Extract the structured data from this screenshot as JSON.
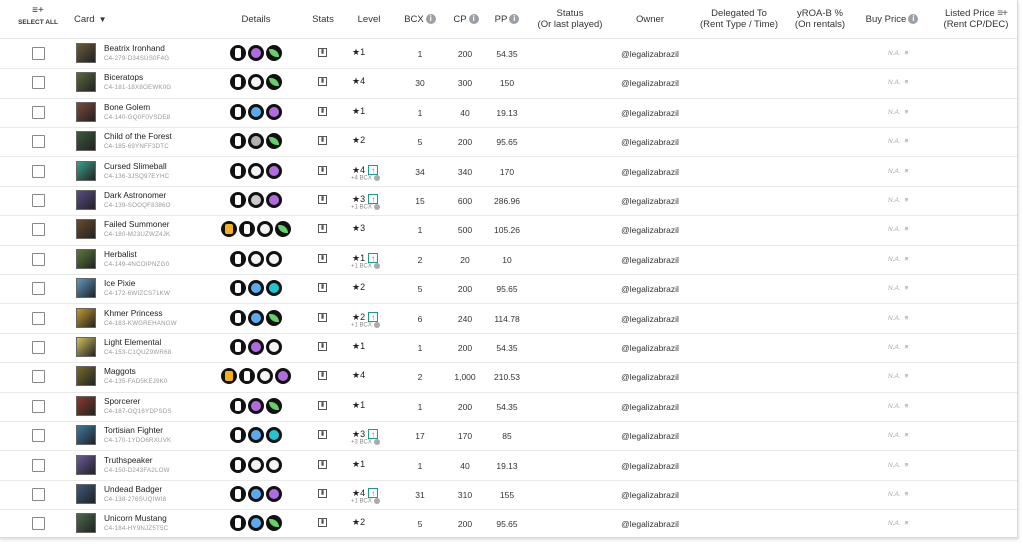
{
  "header": {
    "select_all": "SELECT ALL",
    "card": "Card",
    "details": "Details",
    "stats": "Stats",
    "level": "Level",
    "bcx": "BCX",
    "cp": "CP",
    "pp": "PP",
    "status": "Status",
    "status_sub": "(Or last played)",
    "owner": "Owner",
    "delegated": "Delegated To",
    "delegated_sub": "(Rent Type / Time)",
    "yroa": "yROA-B %",
    "yroa_sub": "(On rentals)",
    "buy_price": "Buy Price",
    "listed_price": "Listed Price",
    "listed_price_sub": "(Rent CP/DEC)"
  },
  "na_label": "N.A.",
  "rows": [
    {
      "name": "Beatrix Ironhand",
      "id": "C4-279-D34SUS0F4G",
      "details": [
        "white",
        "skull",
        "leaf"
      ],
      "level": "1",
      "up": false,
      "bcx_note": "",
      "bcx": "1",
      "cp": "200",
      "pp": "54.35",
      "owner": "@legalizabrazil",
      "color": "#6a5a3a"
    },
    {
      "name": "Biceratops",
      "id": "C4-181-18X8OEWK0G",
      "details": [
        "white",
        "star",
        "leaf"
      ],
      "level": "4",
      "up": false,
      "bcx_note": "",
      "bcx": "30",
      "cp": "300",
      "pp": "150",
      "owner": "@legalizabrazil",
      "color": "#5a6b3a"
    },
    {
      "name": "Bone Golem",
      "id": "C4-140-GQ0F0VSDE8",
      "details": [
        "white",
        "orb",
        "skull"
      ],
      "level": "1",
      "up": false,
      "bcx_note": "",
      "bcx": "1",
      "cp": "40",
      "pp": "19.13",
      "owner": "@legalizabrazil",
      "color": "#7a4a3a"
    },
    {
      "name": "Child of the Forest",
      "id": "C4-185-69YNFF3DTC",
      "details": [
        "white",
        "orb",
        "leaf"
      ],
      "level": "2",
      "up": false,
      "bcx_note": "",
      "bcx": "5",
      "cp": "200",
      "pp": "95.65",
      "owner": "@legalizabrazil",
      "color": "#3a5a3a"
    },
    {
      "name": "Cursed Slimeball",
      "id": "C4-136-3JSQ97EYHC",
      "details": [
        "white",
        "star",
        "skull"
      ],
      "level": "4",
      "up": true,
      "bcx_note": "+4 BCX",
      "bcx": "34",
      "cp": "340",
      "pp": "170",
      "owner": "@legalizabrazil",
      "color": "#3aa08a"
    },
    {
      "name": "Dark Astronomer",
      "id": "C4-139-SOOQF8386O",
      "details": [
        "white",
        "orb",
        "skull"
      ],
      "level": "3",
      "up": true,
      "bcx_note": "+1 BCX",
      "bcx": "15",
      "cp": "600",
      "pp": "286.96",
      "owner": "@legalizabrazil",
      "color": "#5a4a8a"
    },
    {
      "name": "Failed Summoner",
      "id": "C4-180-M23UZWZ4JK",
      "details": [
        "gold",
        "white",
        "star",
        "leaf"
      ],
      "level": "3",
      "up": false,
      "bcx_note": "",
      "bcx": "1",
      "cp": "500",
      "pp": "105.26",
      "owner": "@legalizabrazil",
      "color": "#6a4a2a"
    },
    {
      "name": "Herbalist",
      "id": "C4-149-4NCOIPNZG0",
      "details": [
        "white",
        "star",
        "star"
      ],
      "level": "1",
      "up": true,
      "bcx_note": "+1 BCX",
      "bcx": "2",
      "cp": "20",
      "pp": "10",
      "owner": "@legalizabrazil",
      "color": "#5a7a3a"
    },
    {
      "name": "Ice Pixie",
      "id": "C4-172-6WIZCS71KW",
      "details": [
        "white",
        "orb",
        "ring"
      ],
      "level": "2",
      "up": false,
      "bcx_note": "",
      "bcx": "5",
      "cp": "200",
      "pp": "95.65",
      "owner": "@legalizabrazil",
      "color": "#5a9ac0"
    },
    {
      "name": "Khmer Princess",
      "id": "C4-183-KWGREHANGW",
      "details": [
        "white",
        "orb",
        "leaf"
      ],
      "level": "2",
      "up": true,
      "bcx_note": "+1 BCX",
      "bcx": "6",
      "cp": "240",
      "pp": "114.78",
      "owner": "@legalizabrazil",
      "color": "#c09a2a"
    },
    {
      "name": "Light Elemental",
      "id": "C4-153-C1QUZ9WR68",
      "details": [
        "white",
        "skull",
        "star"
      ],
      "level": "1",
      "up": false,
      "bcx_note": "",
      "bcx": "1",
      "cp": "200",
      "pp": "54.35",
      "owner": "@legalizabrazil",
      "color": "#d0c060"
    },
    {
      "name": "Maggots",
      "id": "C4-135-FAD5KEJ9K0",
      "details": [
        "gold",
        "white",
        "star",
        "skull"
      ],
      "level": "4",
      "up": false,
      "bcx_note": "",
      "bcx": "2",
      "cp": "1,000",
      "pp": "210.53",
      "owner": "@legalizabrazil",
      "color": "#7a6a2a"
    },
    {
      "name": "Sporcerer",
      "id": "C4-187-OQ16YDPSDS",
      "details": [
        "white",
        "skull",
        "leaf"
      ],
      "level": "1",
      "up": false,
      "bcx_note": "",
      "bcx": "1",
      "cp": "200",
      "pp": "54.35",
      "owner": "@legalizabrazil",
      "color": "#8a3a2a"
    },
    {
      "name": "Tortisian Fighter",
      "id": "C4-170-1YDO6RXUVK",
      "details": [
        "white",
        "orb",
        "ring"
      ],
      "level": "3",
      "up": true,
      "bcx_note": "+3 BCX",
      "bcx": "17",
      "cp": "170",
      "pp": "85",
      "owner": "@legalizabrazil",
      "color": "#3a7aa0"
    },
    {
      "name": "Truthspeaker",
      "id": "C4-150-D243FA2LOW",
      "details": [
        "white",
        "star",
        "star"
      ],
      "level": "1",
      "up": false,
      "bcx_note": "",
      "bcx": "1",
      "cp": "40",
      "pp": "19.13",
      "owner": "@legalizabrazil",
      "color": "#6a5a9a"
    },
    {
      "name": "Undead Badger",
      "id": "C4-138-276SUQIWI8",
      "details": [
        "white",
        "orb",
        "skull"
      ],
      "level": "4",
      "up": true,
      "bcx_note": "+1 BCX",
      "bcx": "31",
      "cp": "310",
      "pp": "155",
      "owner": "@legalizabrazil",
      "color": "#3a5a7a"
    },
    {
      "name": "Unicorn Mustang",
      "id": "C4-184-HY9NJZ5T5C",
      "details": [
        "white",
        "orb",
        "leaf"
      ],
      "level": "2",
      "up": false,
      "bcx_note": "",
      "bcx": "5",
      "cp": "200",
      "pp": "95.65",
      "owner": "@legalizabrazil",
      "color": "#4a6a4a"
    }
  ]
}
